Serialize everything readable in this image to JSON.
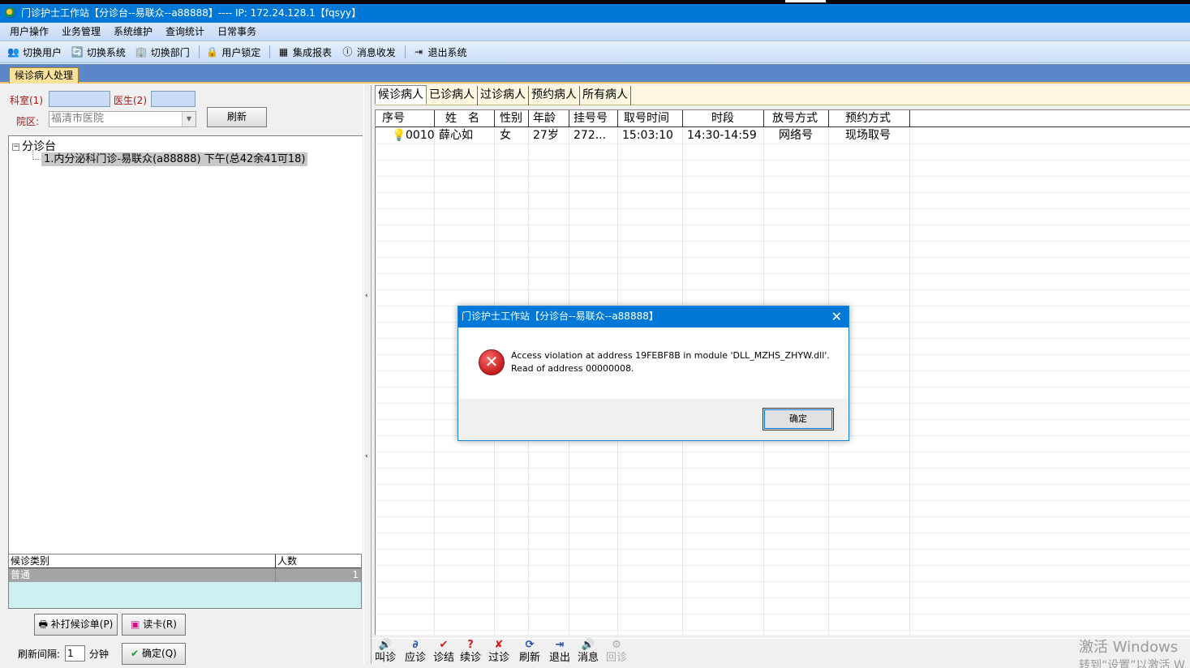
{
  "window": {
    "title": "门诊护士工作站【分诊台--易联众--a88888】---- IP:  172.24.128.1【fqsyy】"
  },
  "menu": [
    "用户操作",
    "业务管理",
    "系统维护",
    "查询统计",
    "日常事务"
  ],
  "toolbar": [
    {
      "label": "切换用户",
      "icon": "switch-user-icon",
      "glyph": "👥"
    },
    {
      "label": "切换系统",
      "icon": "switch-system-icon",
      "glyph": "🔄"
    },
    {
      "label": "切换部门",
      "icon": "switch-dept-icon",
      "glyph": "🏢"
    },
    {
      "label": "用户锁定",
      "icon": "lock-user-icon",
      "glyph": "🔒"
    },
    {
      "label": "集成报表",
      "icon": "report-icon",
      "glyph": "▦"
    },
    {
      "label": "消息收发",
      "icon": "message-icon",
      "glyph": "ⓘ"
    },
    {
      "label": "退出系统",
      "icon": "exit-icon",
      "glyph": "⇥"
    }
  ],
  "doc_tab": "候诊病人处理",
  "left": {
    "dept_label": "科室(1)",
    "doctor_label": "医生(2)",
    "campus_label": "院区:",
    "campus_value": "福清市医院",
    "refresh_label": "刷新",
    "tree_root": "分诊台",
    "tree_item": "1.内分泌科门诊-易联众(a88888) 下午(总42余41可18)",
    "category_headers": [
      "候诊类别",
      "人数"
    ],
    "category_rows": [
      {
        "name": "普通",
        "count": "1"
      }
    ],
    "reprint_label": "补打候诊单(P)",
    "readcard_label": "读卡(R)",
    "interval_label": "刷新间隔:",
    "interval_value": "1",
    "interval_unit": "分钟",
    "confirm_label": "确定(Q)"
  },
  "patient_tabs": [
    "候诊病人",
    "已诊病人",
    "过诊病人",
    "预约病人",
    "所有病人"
  ],
  "patient_grid": {
    "headers": [
      "序号",
      "姓　名",
      "性别",
      "年龄",
      "挂号号",
      "取号时间",
      "时段",
      "放号方式",
      "预约方式"
    ],
    "rows": [
      {
        "seq": "0010",
        "name": "薛心如",
        "sex": "女",
        "age": "27岁",
        "reg": "272...",
        "time": "15:03:10",
        "period": "14:30-14:59",
        "release": "网络号",
        "booking": "现场取号"
      }
    ]
  },
  "actions": [
    {
      "label": "叫诊",
      "glyph": "🔊",
      "color": "#444444",
      "enabled": true
    },
    {
      "label": "应诊",
      "glyph": "∂",
      "color": "#1f4fb0",
      "enabled": true
    },
    {
      "label": "诊结",
      "glyph": "✔",
      "color": "#d11f1f",
      "enabled": true
    },
    {
      "label": "续诊",
      "glyph": "?",
      "color": "#d11f1f",
      "enabled": true
    },
    {
      "label": "过诊",
      "glyph": "✘",
      "color": "#d11f1f",
      "enabled": true
    },
    {
      "label": "刷新",
      "glyph": "⟳",
      "color": "#1f4fb0",
      "enabled": true
    },
    {
      "label": "退出",
      "glyph": "⇥",
      "color": "#1f4fb0",
      "enabled": true
    },
    {
      "label": "消息",
      "glyph": "🔊",
      "color": "#444444",
      "enabled": true
    },
    {
      "label": "回诊",
      "glyph": "⚙",
      "color": "#aaaaaa",
      "enabled": false
    }
  ],
  "dialog": {
    "title": "门诊护士工作站【分诊台--易联众--a88888】",
    "line1": "Access violation at address 19FEBF8B in module 'DLL_MZHS_ZHYW.dll'.",
    "line2": "Read of address 00000008.",
    "ok_label": "确定"
  },
  "watermark": {
    "line1": "激活 Windows",
    "line2": "转到“设置”以激活 W"
  },
  "colors": {
    "titlebar": "#0078d7",
    "tab_yellow": "#fbe29a",
    "category_bg": "#cdf1f1"
  }
}
